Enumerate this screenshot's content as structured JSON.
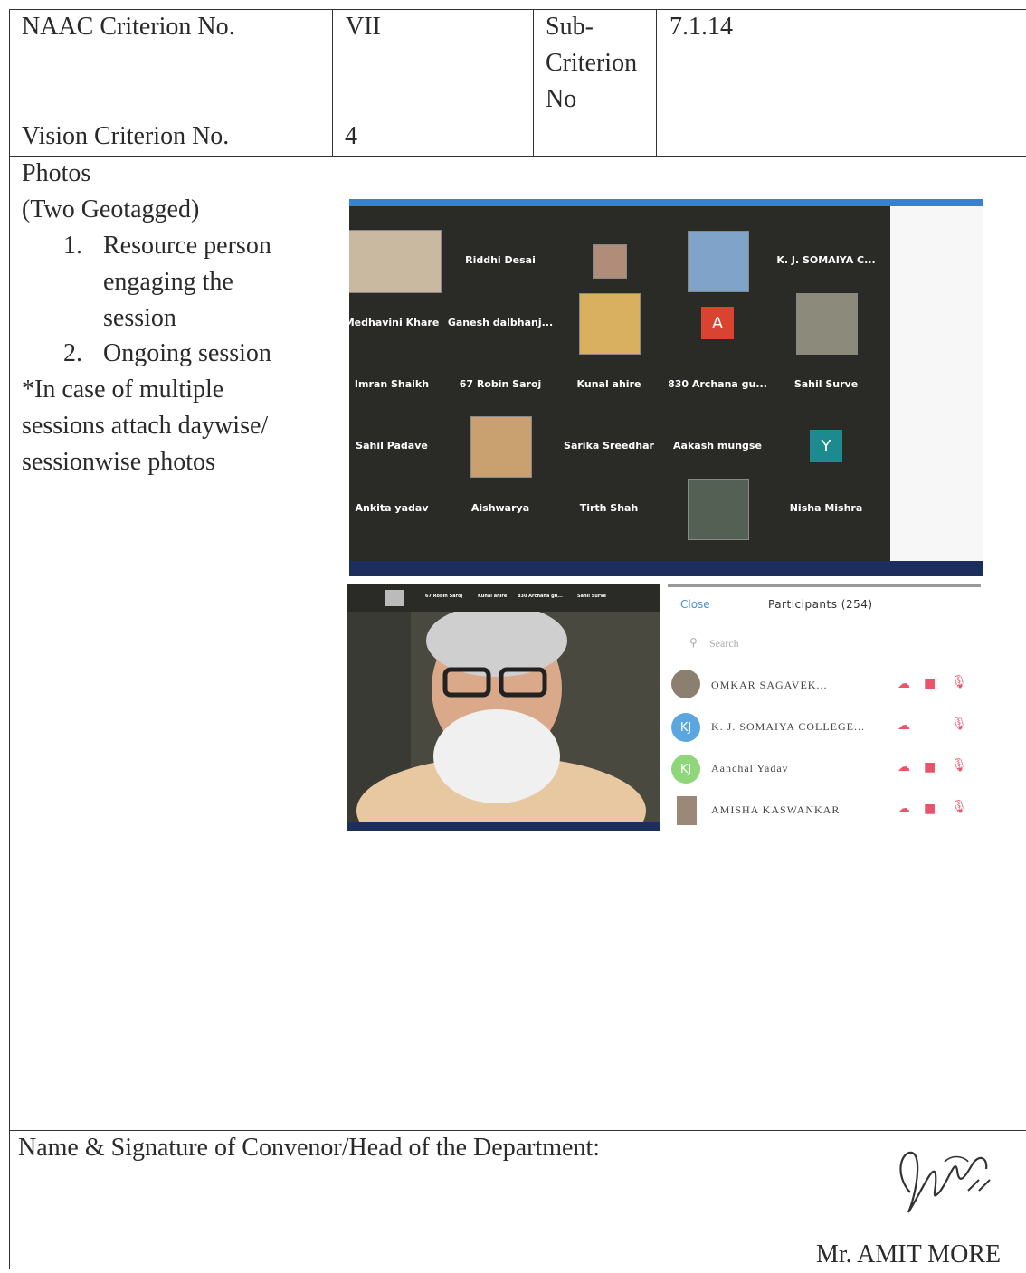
{
  "table": {
    "row1": {
      "label": "NAAC Criterion No.",
      "value": "VII",
      "sub_label": [
        "Sub-",
        "Criterion",
        "No"
      ],
      "sub_value": "7.1.14"
    },
    "row2": {
      "label": "Vision Criterion No.",
      "value": "4"
    },
    "row3": {
      "lines": [
        "Photos",
        "(Two Geotagged)"
      ],
      "items": [
        {
          "num": "1.",
          "lines": [
            "Resource person",
            "engaging the",
            "session"
          ]
        },
        {
          "num": "2.",
          "lines": [
            "Ongoing session"
          ]
        }
      ],
      "note": [
        "*In case of multiple",
        "sessions attach daywise/",
        "sessionwise photos"
      ]
    },
    "footer": {
      "label": "Name & Signature of Convenor/Head of the Department:",
      "name": "Mr. AMIT MORE"
    }
  },
  "gallery": {
    "tiles": [
      [
        "",
        "Riddhi Desai",
        "",
        "",
        "K. J. SOMAIYA C..."
      ],
      [
        "Medhavini Khare",
        "Ganesh dalbhanj...",
        "",
        "A",
        ""
      ],
      [
        "Imran Shaikh",
        "67 Robin Saroj",
        "Kunal ahire",
        "830 Archana gu...",
        "Sahil Surve"
      ],
      [
        "Sahil Padave",
        "",
        "Sarika Sreedhar",
        "Aakash mungse",
        "Y"
      ],
      [
        "Ankita yadav",
        "Aishwarya",
        "Tirth Shah",
        "",
        "Nisha Mishra"
      ]
    ]
  },
  "speaker_strip": [
    "67 Robin Saroj",
    "Kunal ahire",
    "830 Archana gu...",
    "Sahil Surve"
  ],
  "participants": {
    "close": "Close",
    "title": "Participants (254)",
    "search": "Search",
    "list": [
      {
        "initials": "",
        "name": "OMKAR SAGAVEK..."
      },
      {
        "initials": "KJ",
        "name": "K. J. SOMAIYA COLLEGE..."
      },
      {
        "initials": "KJ",
        "name": "Aanchal Yadav"
      },
      {
        "initials": "",
        "name": "AMISHA KASWANKAR"
      }
    ]
  },
  "colors": {
    "accent": "#4a90d9",
    "mute_red": "#e9546b",
    "kj_blue": "#5aa7e0",
    "kj_green": "#8fd67a",
    "avatar_a": "#d9432f",
    "avatar_y": "#1c8a8f"
  }
}
